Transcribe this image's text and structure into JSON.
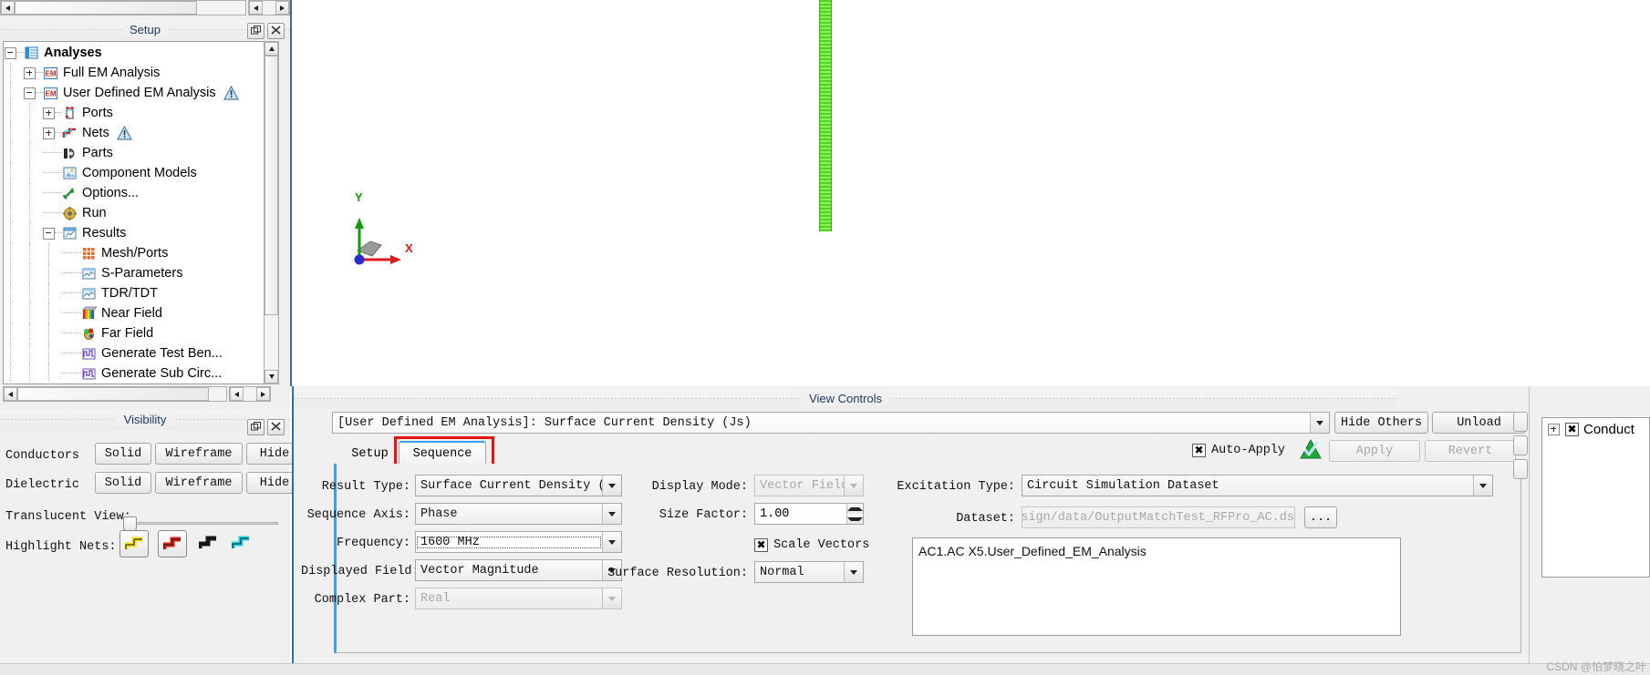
{
  "setup_panel": {
    "title": "Setup",
    "tree": [
      {
        "label": "Analyses",
        "depth": 0,
        "icon": "analyses-icon",
        "toggle": "minus",
        "bold": true,
        "warn": false
      },
      {
        "label": "Full EM Analysis",
        "depth": 1,
        "icon": "em-icon",
        "toggle": "plus",
        "bold": false,
        "warn": false
      },
      {
        "label": "User Defined EM Analysis",
        "depth": 1,
        "icon": "em-icon",
        "toggle": "minus",
        "bold": false,
        "warn": true
      },
      {
        "label": "Ports",
        "depth": 2,
        "icon": "ports-icon",
        "toggle": "plus",
        "bold": false,
        "warn": false
      },
      {
        "label": "Nets",
        "depth": 2,
        "icon": "nets-icon",
        "toggle": "plus",
        "bold": false,
        "warn": true
      },
      {
        "label": "Parts",
        "depth": 2,
        "icon": "parts-icon",
        "toggle": "none",
        "bold": false,
        "warn": false
      },
      {
        "label": "Component Models",
        "depth": 2,
        "icon": "component-models-icon",
        "toggle": "none",
        "bold": false,
        "warn": false
      },
      {
        "label": "Options...",
        "depth": 2,
        "icon": "options-icon",
        "toggle": "none",
        "bold": false,
        "warn": false
      },
      {
        "label": "Run",
        "depth": 2,
        "icon": "run-icon",
        "toggle": "none",
        "bold": false,
        "warn": false
      },
      {
        "label": "Results",
        "depth": 2,
        "icon": "results-icon",
        "toggle": "minus",
        "bold": false,
        "warn": false
      },
      {
        "label": "Mesh/Ports",
        "depth": 3,
        "icon": "mesh-ports-icon",
        "toggle": "none",
        "bold": false,
        "warn": false
      },
      {
        "label": "S-Parameters",
        "depth": 3,
        "icon": "s-parameters-icon",
        "toggle": "none",
        "bold": false,
        "warn": false
      },
      {
        "label": "TDR/TDT",
        "depth": 3,
        "icon": "tdr-tdt-icon",
        "toggle": "none",
        "bold": false,
        "warn": false
      },
      {
        "label": "Near Field",
        "depth": 3,
        "icon": "near-field-icon",
        "toggle": "none",
        "bold": false,
        "warn": false
      },
      {
        "label": "Far Field",
        "depth": 3,
        "icon": "far-field-icon",
        "toggle": "none",
        "bold": false,
        "warn": false
      },
      {
        "label": "Generate Test Ben...",
        "depth": 3,
        "icon": "generate-test-bench-icon",
        "toggle": "none",
        "bold": false,
        "warn": false
      },
      {
        "label": "Generate Sub Circ...",
        "depth": 3,
        "icon": "generate-sub-circuit-icon",
        "toggle": "none",
        "bold": false,
        "warn": false
      }
    ]
  },
  "visibility_panel": {
    "title": "Visibility",
    "rows": [
      {
        "label": "Conductors",
        "buttons": [
          "Solid",
          "Wireframe",
          "Hide"
        ]
      },
      {
        "label": "Dielectric",
        "buttons": [
          "Solid",
          "Wireframe",
          "Hide"
        ]
      }
    ],
    "translucent_label": "Translucent View:",
    "translucent_value": 0,
    "highlight_label": "Highlight Nets:",
    "highlight_colors": [
      "#f2e317",
      "#e22214",
      "#1a1a1a",
      "#16d6e8"
    ]
  },
  "view_controls": {
    "title": "View Controls",
    "result_combo": "[User Defined EM Analysis]: Surface Current Density (Js)",
    "hide_others_label": "Hide Others",
    "unload_label": "Unload",
    "tabs": [
      {
        "label": "Setup",
        "selected": false,
        "highlight": false
      },
      {
        "label": "Sequence",
        "selected": true,
        "highlight": true
      }
    ],
    "auto_apply_label": "Auto-Apply",
    "auto_apply_checked": true,
    "apply_label": "Apply",
    "revert_label": "Revert",
    "fields_left": [
      {
        "label": "Result Type:",
        "value": "Surface Current Density (Js)",
        "disabled": false,
        "focus": false
      },
      {
        "label": "Sequence Axis:",
        "value": "Phase",
        "disabled": false,
        "focus": false
      },
      {
        "label": "Frequency:",
        "value": "1600 MHz",
        "disabled": false,
        "focus": true
      },
      {
        "label": "Displayed Field:",
        "value": "Vector Magnitude",
        "disabled": false,
        "focus": false
      },
      {
        "label": "Complex Part:",
        "value": "Real",
        "disabled": true,
        "focus": false
      }
    ],
    "fields_mid": {
      "display_mode_label": "Display Mode:",
      "display_mode_value": "Vector Field",
      "size_factor_label": "Size Factor:",
      "size_factor_value": "1.00",
      "scale_vectors_label": "Scale Vectors",
      "scale_vectors_checked": true,
      "surface_resolution_label": "Surface Resolution:",
      "surface_resolution_value": "Normal"
    },
    "fields_right": {
      "excitation_label": "Excitation Type:",
      "excitation_value": "Circuit Simulation Dataset",
      "dataset_label": "Dataset:",
      "dataset_value": "ch_Design/data/OutputMatchTest_RFPro_AC.ds",
      "dataset_browse": "...",
      "list_items": [
        "AC1.AC X5.User_Defined_EM_Analysis"
      ]
    }
  },
  "right_panel": {
    "items": [
      {
        "label": "Conduct",
        "toggle": "plus",
        "checked": true
      }
    ]
  },
  "viewport": {
    "axis_x": "X",
    "axis_y": "Y",
    "trace_color": "#66e03c"
  },
  "watermark": "CSDN @怕梦晓之叶"
}
